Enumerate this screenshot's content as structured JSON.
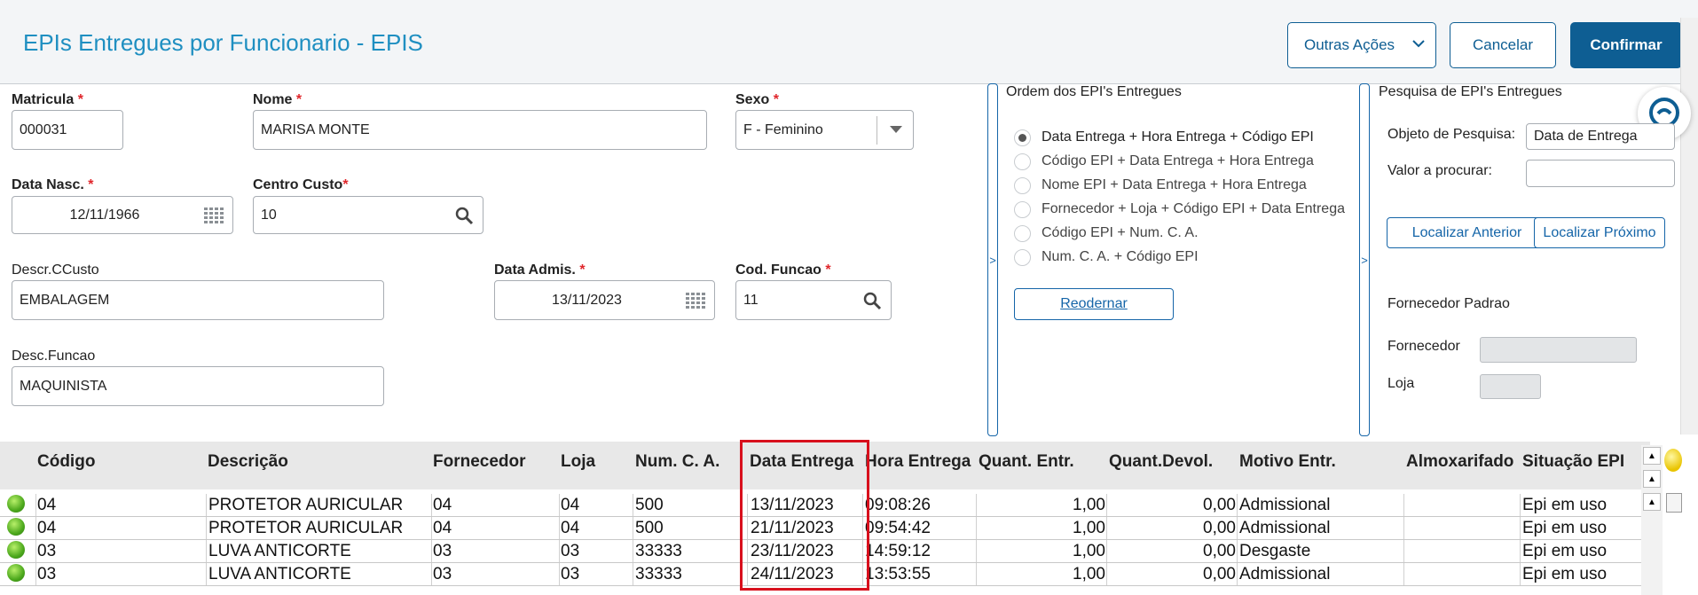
{
  "header": {
    "title": "EPIs Entregues por Funcionario - EPIS",
    "more_actions_label": "Outras Ações",
    "cancel_label": "Cancelar",
    "confirm_label": "Confirmar"
  },
  "form": {
    "matricula": {
      "label": "Matricula",
      "required_mark": "*",
      "value": "000031"
    },
    "nome": {
      "label": "Nome",
      "required_mark": "*",
      "value": "MARISA MONTE"
    },
    "sexo": {
      "label": "Sexo",
      "required_mark": "*",
      "value": "F - Feminino"
    },
    "data_nasc": {
      "label": "Data Nasc.",
      "required_mark": "*",
      "value": "12/11/1966"
    },
    "centro_custo": {
      "label": "Centro Custo",
      "required_mark": "*",
      "value": "10"
    },
    "descr_ccusto": {
      "label": "Descr.CCusto",
      "value": "EMBALAGEM"
    },
    "data_admis": {
      "label": "Data Admis.",
      "required_mark": "*",
      "value": "13/11/2023"
    },
    "cod_funcao": {
      "label": "Cod. Funcao",
      "required_mark": "*",
      "value": "11"
    },
    "desc_funcao": {
      "label": "Desc.Funcao",
      "value": "MAQUINISTA"
    }
  },
  "order_panel": {
    "title": "Ordem dos EPI's Entregues",
    "collapse_glyph": ">",
    "options": [
      {
        "label": "Data Entrega + Hora Entrega + Código EPI",
        "selected": true
      },
      {
        "label": "Código EPI + Data Entrega + Hora Entrega",
        "selected": false
      },
      {
        "label": "Nome EPI + Data Entrega + Hora Entrega",
        "selected": false
      },
      {
        "label": "Fornecedor + Loja + Código EPI + Data Entrega",
        "selected": false
      },
      {
        "label": "Código EPI +  Num. C. A.",
        "selected": false
      },
      {
        "label": "Num. C. A. + Código EPI",
        "selected": false
      }
    ],
    "reorder_label": "Reodernar"
  },
  "search_panel": {
    "title": "Pesquisa de EPI's Entregues",
    "collapse_glyph": ">",
    "object_label": "Objeto de Pesquisa:",
    "object_value": "Data de Entrega",
    "value_label": "Valor a procurar:",
    "value_value": "",
    "prev_label": "Localizar Anterior",
    "next_label": "Localizar Próximo",
    "default_supplier_label": "Fornecedor Padrao",
    "supplier_label": "Fornecedor",
    "store_label": "Loja"
  },
  "grid": {
    "columns": [
      "Código",
      "Descrição",
      "Fornecedor",
      "Loja",
      "Num. C. A.",
      "Data Entrega",
      "Hora Entrega",
      "Quant. Entr.",
      "Quant.Devol.",
      "Motivo Entr.",
      "Almoxarifado",
      "Situação EPI"
    ],
    "rows": [
      [
        "04",
        "PROTETOR AURICULAR",
        "04",
        "04",
        "500",
        "13/11/2023",
        "09:08:26",
        "1,00",
        "0,00",
        "Admissional",
        "",
        "Epi em uso"
      ],
      [
        "04",
        "PROTETOR AURICULAR",
        "04",
        "04",
        "500",
        "21/11/2023",
        "09:54:42",
        "1,00",
        "0,00",
        "Admissional",
        "",
        "Epi em uso"
      ],
      [
        "03",
        "LUVA  ANTICORTE",
        "03",
        "03",
        "33333",
        "23/11/2023",
        "14:59:12",
        "1,00",
        "0,00",
        "Desgaste",
        "",
        "Epi em uso"
      ],
      [
        "03",
        "LUVA  ANTICORTE",
        "03",
        "03",
        "33333",
        "24/11/2023",
        "13:53:55",
        "1,00",
        "0,00",
        "Admissional",
        "",
        "Epi em uso"
      ]
    ],
    "row_status_icon": "green-led-icon"
  },
  "colors": {
    "title": "#1f8fc1",
    "primary": "#0e5e93",
    "required": "#e0262b",
    "highlight": "#d8101d"
  }
}
